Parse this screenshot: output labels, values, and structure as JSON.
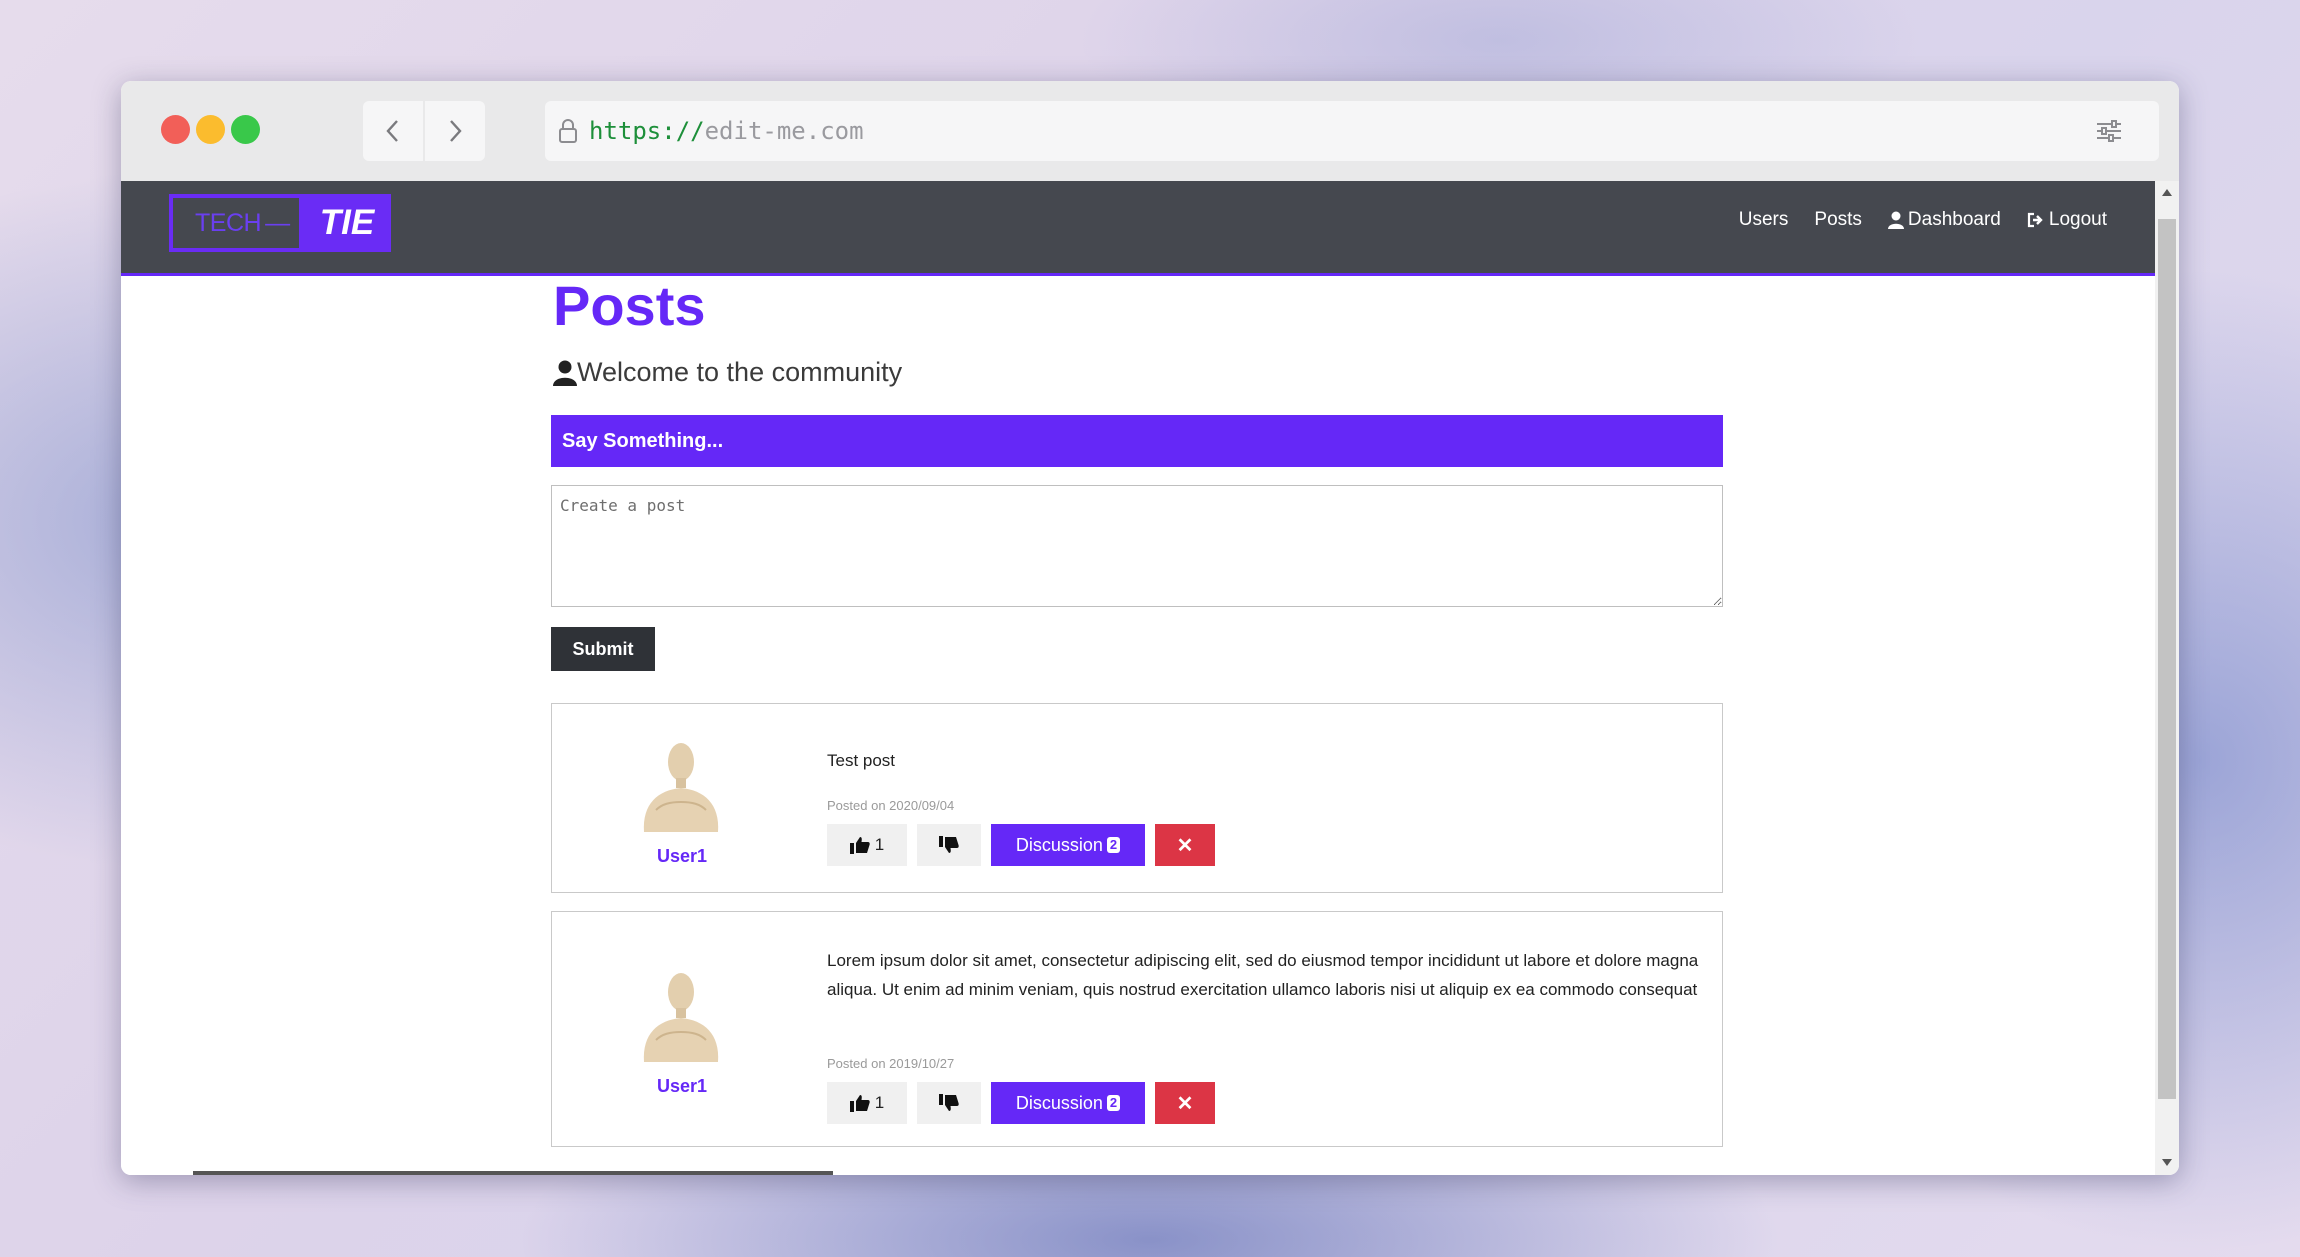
{
  "browser": {
    "url_scheme": "https://",
    "url_host": "edit-me.com"
  },
  "navbar": {
    "logo_left": "TECH",
    "logo_dash": "—",
    "logo_right": "TIE",
    "links": {
      "users": "Users",
      "posts": "Posts",
      "dashboard": "Dashboard",
      "logout": "Logout"
    }
  },
  "page": {
    "title": "Posts",
    "welcome": "Welcome to the community",
    "say_something": "Say Something...",
    "input_placeholder": "Create a post",
    "submit": "Submit"
  },
  "posts": [
    {
      "user": "User1",
      "text": "Test post",
      "date": "Posted on 2020/09/04",
      "likes": "1",
      "discussion_label": "Discussion",
      "discussion_count": "2",
      "delete": "✕"
    },
    {
      "user": "User1",
      "text": "Lorem ipsum dolor sit amet, consectetur adipiscing elit, sed do eiusmod tempor incididunt ut labore et dolore magna aliqua. Ut enim ad minim veniam, quis nostrud exercitation ullamco laboris nisi ut aliquip ex ea commodo consequat",
      "date": "Posted on 2019/10/27",
      "likes": "1",
      "discussion_label": "Discussion",
      "discussion_count": "2",
      "delete": "✕"
    }
  ],
  "colors": {
    "brand": "#6528f7",
    "navbar": "#45484f",
    "danger": "#dc3545"
  }
}
